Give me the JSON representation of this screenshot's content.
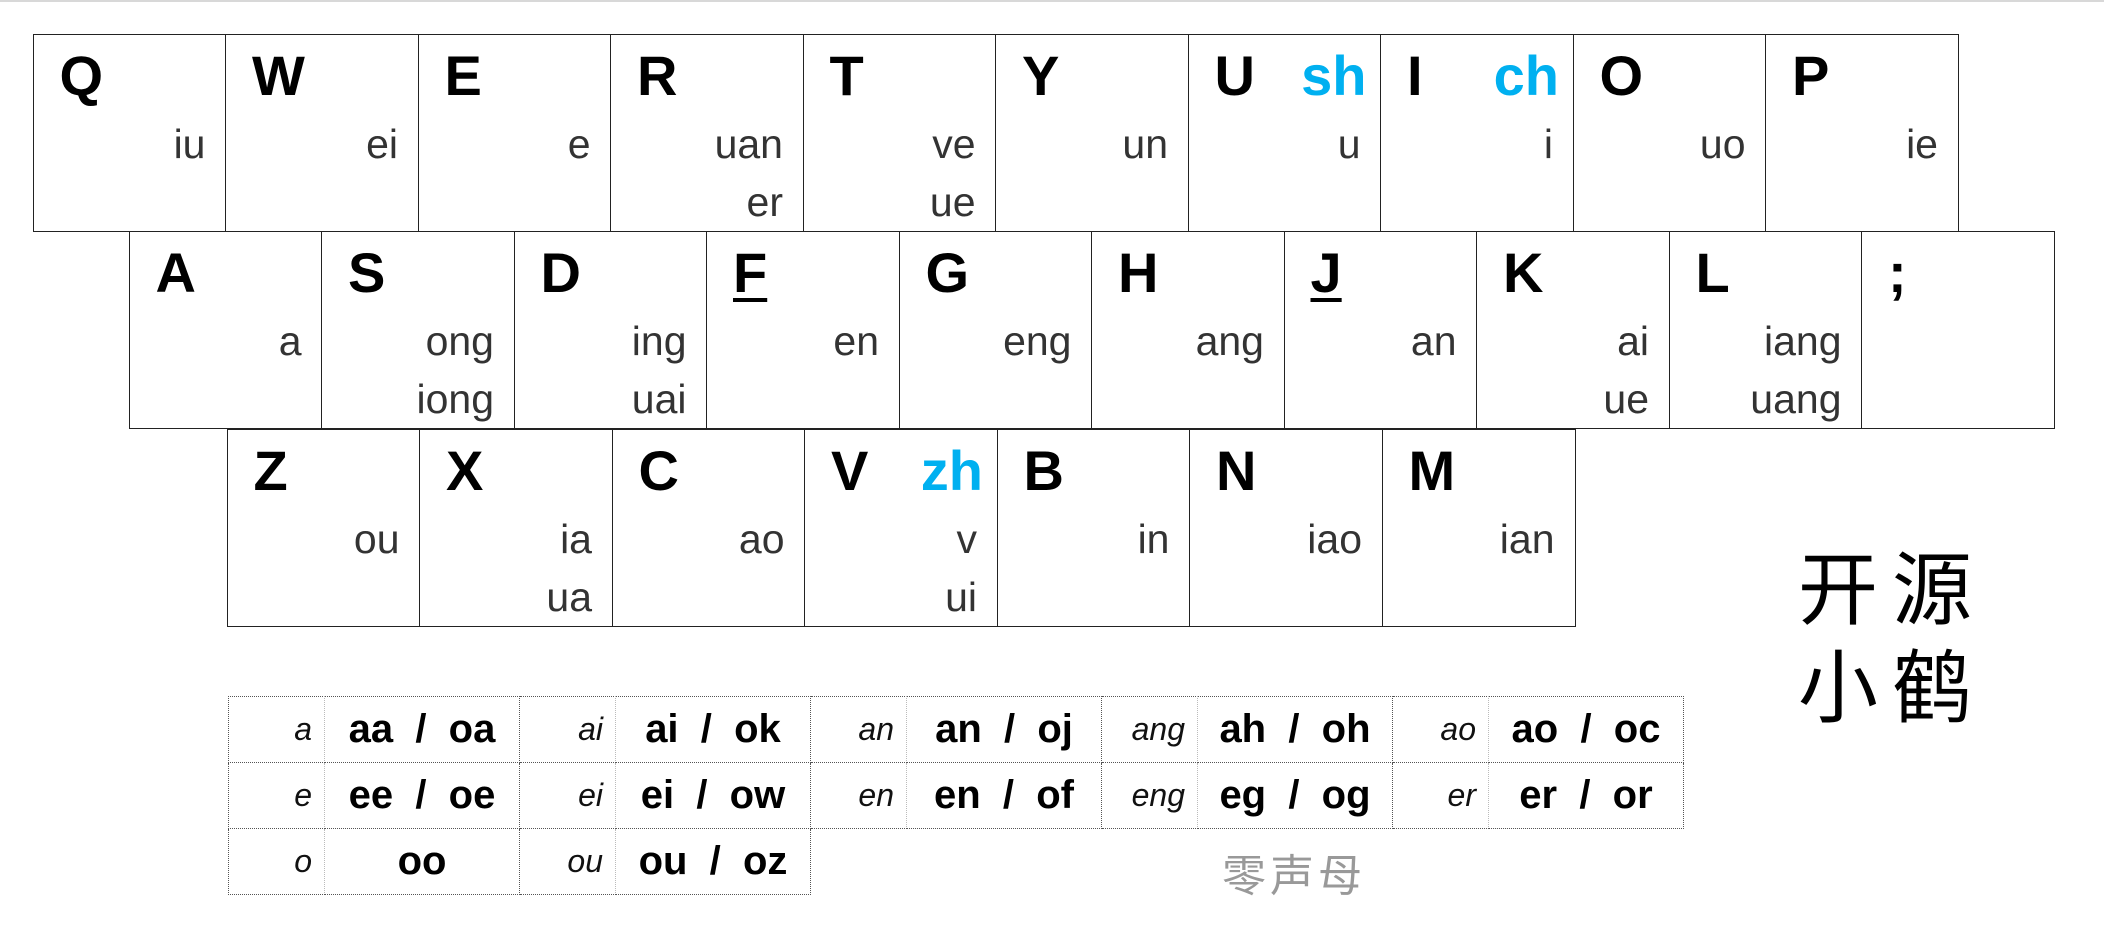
{
  "keyboard": {
    "row1": [
      {
        "key": "Q",
        "finals": [
          "iu"
        ]
      },
      {
        "key": "W",
        "finals": [
          "ei"
        ]
      },
      {
        "key": "E",
        "finals": [
          "e"
        ]
      },
      {
        "key": "R",
        "finals": [
          "uan",
          "er"
        ]
      },
      {
        "key": "T",
        "finals": [
          "ve",
          "ue"
        ]
      },
      {
        "key": "Y",
        "finals": [
          "un"
        ]
      },
      {
        "key": "U",
        "initial": "sh",
        "finals": [
          "u"
        ]
      },
      {
        "key": "I",
        "initial": "ch",
        "finals": [
          "i"
        ]
      },
      {
        "key": "O",
        "finals": [
          "uo"
        ]
      },
      {
        "key": "P",
        "finals": [
          "ie"
        ]
      }
    ],
    "row2": [
      {
        "key": "A",
        "finals": [
          "a"
        ]
      },
      {
        "key": "S",
        "finals": [
          "ong",
          "iong"
        ]
      },
      {
        "key": "D",
        "finals": [
          "ing",
          "uai"
        ]
      },
      {
        "key": "F",
        "underline": true,
        "finals": [
          "en"
        ]
      },
      {
        "key": "G",
        "finals": [
          "eng"
        ]
      },
      {
        "key": "H",
        "finals": [
          "ang"
        ]
      },
      {
        "key": "J",
        "underline": true,
        "finals": [
          "an"
        ]
      },
      {
        "key": "K",
        "finals": [
          "ai",
          "ue"
        ]
      },
      {
        "key": "L",
        "finals": [
          "iang",
          "uang"
        ]
      },
      {
        "key": ";",
        "finals": []
      }
    ],
    "row3": [
      {
        "key": "Z",
        "finals": [
          "ou"
        ]
      },
      {
        "key": "X",
        "finals": [
          "ia",
          "ua"
        ]
      },
      {
        "key": "C",
        "finals": [
          "ao"
        ]
      },
      {
        "key": "V",
        "initial": "zh",
        "finals": [
          "v",
          "ui"
        ]
      },
      {
        "key": "B",
        "finals": [
          "in"
        ]
      },
      {
        "key": "N",
        "finals": [
          "iao"
        ]
      },
      {
        "key": "M",
        "finals": [
          "ian"
        ]
      }
    ]
  },
  "zero_initial": {
    "rows": [
      [
        [
          "a",
          "aa  /  oa"
        ],
        [
          "ai",
          "ai  /  ok"
        ],
        [
          "an",
          "an  /  oj"
        ],
        [
          "ang",
          "ah  /  oh"
        ],
        [
          "ao",
          "ao  /  oc"
        ]
      ],
      [
        [
          "e",
          "ee  /  oe"
        ],
        [
          "ei",
          "ei  /  ow"
        ],
        [
          "en",
          "en  /  of"
        ],
        [
          "eng",
          "eg  /  og"
        ],
        [
          "er",
          "er  /  or"
        ]
      ],
      [
        [
          "o",
          "oo"
        ],
        [
          "ou",
          "ou  /  oz"
        ]
      ]
    ],
    "caption": "零声母"
  },
  "logo": {
    "line1": "开源",
    "line2": "小鹤"
  },
  "colors": {
    "initial": "#00b0f0",
    "final": "#333333"
  }
}
